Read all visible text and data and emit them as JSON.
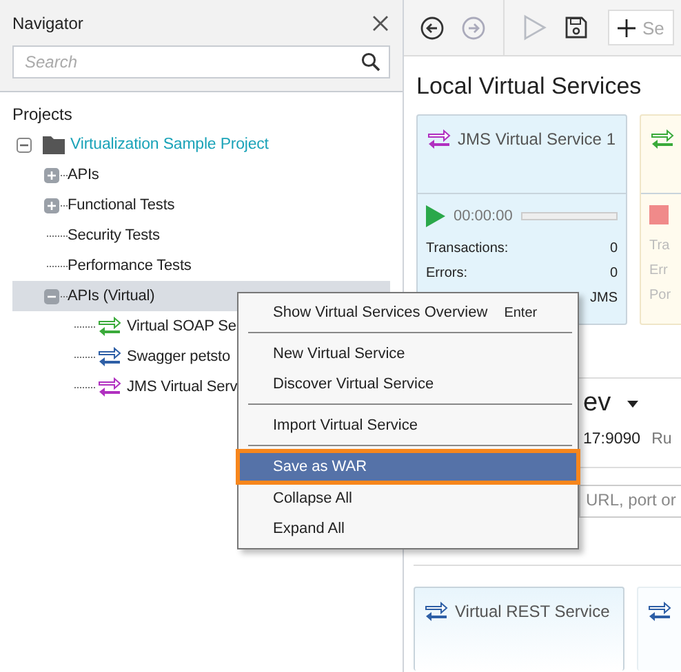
{
  "navigator": {
    "title": "Navigator",
    "search": {
      "placeholder": "Search"
    },
    "section": "Projects",
    "tree": [
      {
        "label": "Virtualization Sample Project",
        "kind": "project",
        "expanded": true,
        "selected": false,
        "children": [
          {
            "label": "APIs",
            "expanded": false,
            "selected": false
          },
          {
            "label": "Functional Tests",
            "expanded": false,
            "selected": false
          },
          {
            "label": "Security Tests",
            "selected": false
          },
          {
            "label": "Performance Tests",
            "selected": false
          },
          {
            "label": "APIs (Virtual)",
            "expanded": true,
            "selected": true,
            "children": [
              {
                "label": "Virtual SOAP Se",
                "kind": "service",
                "color": "#3aaa3a",
                "selected": false
              },
              {
                "label": "Swagger petsto",
                "kind": "service",
                "color": "#2e5fa6",
                "selected": false
              },
              {
                "label": "JMS Virtual Serv",
                "kind": "service",
                "color": "#b030c0",
                "selected": false
              }
            ]
          }
        ]
      }
    ]
  },
  "toolbar": {
    "buttons": [
      {
        "kind": "back",
        "disabled": false
      },
      {
        "kind": "forward",
        "disabled": true
      },
      {
        "kind": "run",
        "disabled": true
      },
      {
        "kind": "save",
        "disabled": false
      }
    ],
    "add_button": "Se"
  },
  "local_services": {
    "title": "Local Virtual Services",
    "cards": [
      {
        "name": "JMS Virtual Service 1",
        "color": "#b030c0",
        "running": false,
        "time": "00:00:00",
        "stats": [
          {
            "label": "Transactions:",
            "value": "0"
          },
          {
            "label": "Errors:",
            "value": "0"
          },
          {
            "value": "JMS"
          }
        ]
      },
      {
        "color": "#3aaa3a",
        "running": true,
        "stats": [
          {
            "label": "Tra"
          },
          {
            "label": "Err"
          },
          {
            "label": "Por"
          }
        ]
      }
    ]
  },
  "remote": {
    "title": "ev",
    "address": "17:9090",
    "status": "Ru",
    "search": {
      "placeholder": "URL, port or"
    },
    "cards": [
      {
        "name": "Virtual REST Service",
        "color": "#2e5fa6"
      },
      {
        "color": "#2e5fa6"
      }
    ]
  },
  "context_menu": {
    "items": [
      {
        "kind": "item",
        "label": "Show Virtual Services Overview",
        "shortcut": "Enter",
        "selected": false
      },
      {
        "kind": "separator"
      },
      {
        "kind": "item",
        "label": "New Virtual Service",
        "selected": false
      },
      {
        "kind": "item",
        "label": "Discover Virtual Service",
        "selected": false
      },
      {
        "kind": "separator"
      },
      {
        "kind": "item",
        "label": "Import Virtual Service",
        "selected": false
      },
      {
        "kind": "separator"
      },
      {
        "kind": "item",
        "label": "Save as WAR",
        "selected": true
      },
      {
        "kind": "item",
        "label": "Collapse All",
        "selected": false
      },
      {
        "kind": "item",
        "label": "Expand All",
        "selected": false
      }
    ]
  }
}
